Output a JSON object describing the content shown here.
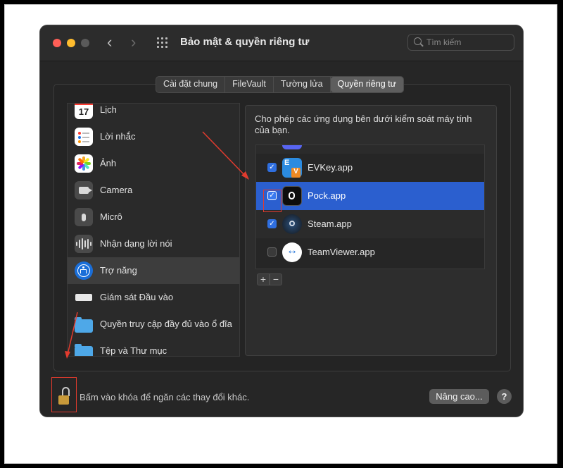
{
  "window": {
    "title": "Bảo mật & quyền riêng tư",
    "search_placeholder": "Tìm kiếm"
  },
  "tabs": [
    {
      "label": "Cài đặt chung",
      "active": false
    },
    {
      "label": "FileVault",
      "active": false
    },
    {
      "label": "Tường lửa",
      "active": false
    },
    {
      "label": "Quyền riêng tư",
      "active": true
    }
  ],
  "sidebar": {
    "items": [
      {
        "label": "Lịch",
        "icon": "calendar-icon",
        "icon_text": "17"
      },
      {
        "label": "Lời nhắc",
        "icon": "reminders-icon"
      },
      {
        "label": "Ảnh",
        "icon": "photos-icon"
      },
      {
        "label": "Camera",
        "icon": "camera-icon"
      },
      {
        "label": "Micrô",
        "icon": "microphone-icon"
      },
      {
        "label": "Nhận dạng lời nói",
        "icon": "speech-recognition-icon"
      },
      {
        "label": "Trợ năng",
        "icon": "accessibility-icon",
        "selected": true
      },
      {
        "label": "Giám sát Đầu vào",
        "icon": "keyboard-icon"
      },
      {
        "label": "Quyền truy cập đầy đủ vào ổ đĩa",
        "icon": "folder-icon"
      },
      {
        "label": "Tệp và Thư mục",
        "icon": "folder-icon"
      }
    ]
  },
  "main": {
    "description": "Cho phép các ứng dụng bên dưới kiểm soát máy tính của bạn.",
    "apps": [
      {
        "name": "EVKey.app",
        "checked": true,
        "icon": "evkey-icon"
      },
      {
        "name": "Pock.app",
        "checked": true,
        "icon": "pock-icon",
        "selected": true
      },
      {
        "name": "Steam.app",
        "checked": true,
        "icon": "steam-icon"
      },
      {
        "name": "TeamViewer.app",
        "checked": false,
        "icon": "teamviewer-icon"
      }
    ],
    "add_label": "+",
    "remove_label": "−"
  },
  "footer": {
    "lock_text": "Bấm vào khóa để ngăn các thay đổi khác.",
    "advanced_label": "Nâng cao...",
    "help_label": "?"
  },
  "colors": {
    "accent": "#2b5fcf",
    "annotation": "#e23b2e",
    "window_bg": "#262626"
  }
}
